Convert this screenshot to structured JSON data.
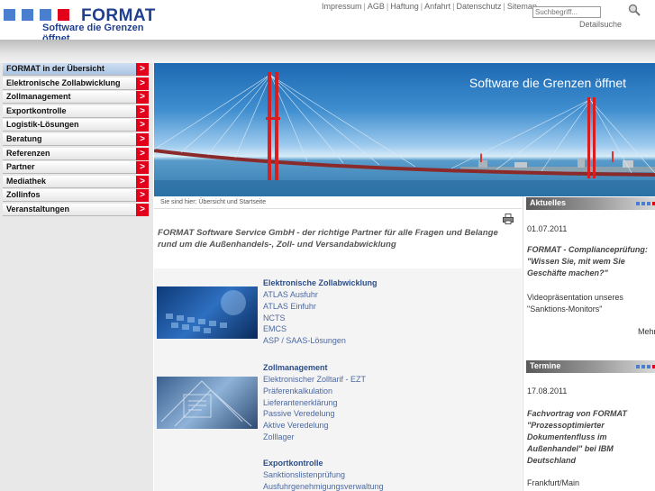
{
  "header": {
    "logo_text": "FORMAT",
    "logo_tagline": "Software die Grenzen öffnet",
    "logo_colors": [
      "#4a7fd0",
      "#4a7fd0",
      "#4a7fd0",
      "#e3001b"
    ],
    "top_links": [
      "Impressum",
      "AGB",
      "Haftung",
      "Anfahrt",
      "Datenschutz",
      "Sitemap"
    ],
    "search_placeholder": "Suchbegriff...",
    "detail_search": "Detailsuche"
  },
  "sidebar": {
    "arrow": ">",
    "items": [
      {
        "label": "FORMAT in der Übersicht"
      },
      {
        "label": "Elektronische Zollabwicklung"
      },
      {
        "label": "Zollmanagement"
      },
      {
        "label": "Exportkontrolle"
      },
      {
        "label": "Logistik-Lösungen"
      },
      {
        "label": "Beratung"
      },
      {
        "label": "Referenzen"
      },
      {
        "label": "Partner"
      },
      {
        "label": "Mediathek"
      },
      {
        "label": "Zollinfos"
      },
      {
        "label": "Veranstaltungen"
      }
    ]
  },
  "banner": {
    "slogan": "Software die Grenzen öffnet"
  },
  "breadcrumb": "Sie sind hier: Übersicht und Startseite",
  "main": {
    "intro": "FORMAT Software Service GmbH - der richtige Partner für alle Fragen und Belange rund um die Außenhandels-, Zoll- und Versandabwicklung",
    "sections": [
      {
        "title": "Elektronische Zollabwicklung",
        "links": [
          "ATLAS Ausfuhr",
          "ATLAS Einfuhr",
          "NCTS",
          "EMCS",
          "ASP / SAAS-Lösungen"
        ]
      },
      {
        "title": "Zollmanagement",
        "links": [
          "Elektronischer Zolltarif - EZT",
          "Präferenkalkulation",
          "Lieferantenerklärung",
          "Passive Veredelung",
          "Aktive Veredelung",
          "Zolllager"
        ]
      },
      {
        "title": "Exportkontrolle",
        "links": [
          "Sanktionslistenprüfung",
          "Ausfuhrgenehmigungsverwaltung"
        ]
      }
    ]
  },
  "aktuelles": {
    "title": "Aktuelles",
    "date": "01.07.2011",
    "headline_lines": [
      "FORMAT - Complianceprüfung:",
      "\"Wissen Sie, mit wem Sie",
      "Geschäfte machen?\""
    ],
    "body_lines": [
      "Videopräsentation unseres",
      "\"Sanktions-Monitors\""
    ],
    "more": "Mehr"
  },
  "termine": {
    "title": "Termine",
    "date": "17.08.2011",
    "headline_lines": [
      "Fachvortrag von FORMAT",
      "\"Prozessoptimierter",
      "Dokumentenfluss im",
      "Außenhandel\" bei IBM",
      "Deutschland"
    ],
    "location": "Frankfurt/Main"
  },
  "colors": {
    "brand_blue": "#1f3f8f",
    "accent_red": "#e3001b",
    "link_blue": "#4c69a3"
  }
}
